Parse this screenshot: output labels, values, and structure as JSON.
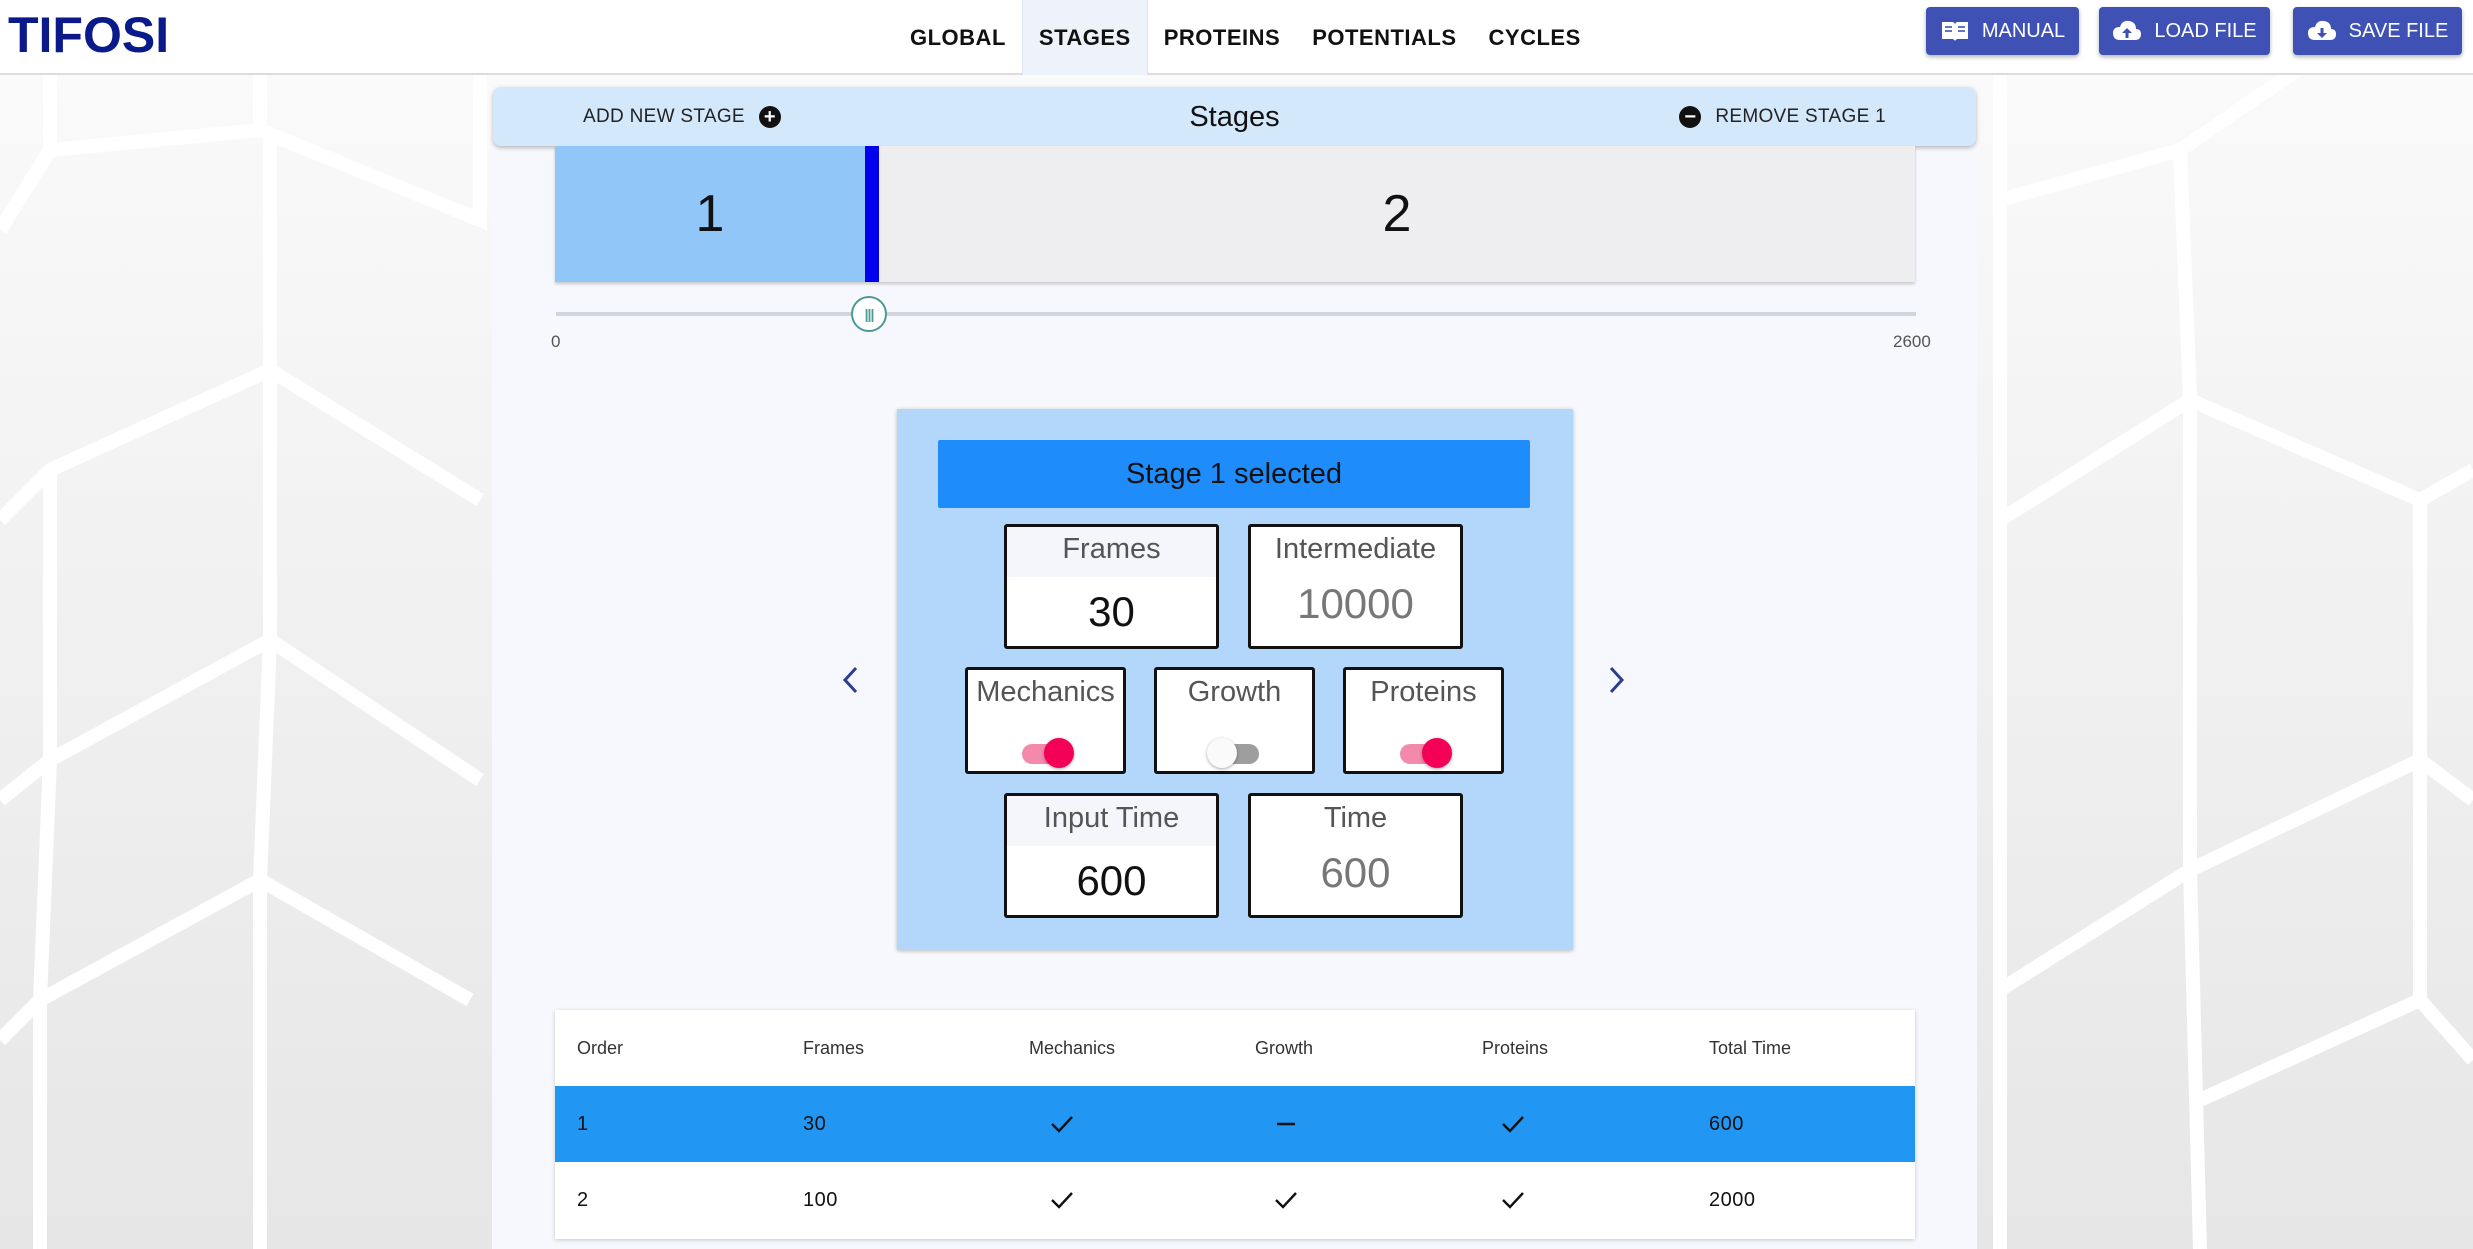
{
  "app": {
    "logo": "TIFOSI"
  },
  "nav": {
    "tabs": [
      {
        "label": "GLOBAL",
        "active": false
      },
      {
        "label": "STAGES",
        "active": true
      },
      {
        "label": "PROTEINS",
        "active": false
      },
      {
        "label": "POTENTIALS",
        "active": false
      },
      {
        "label": "CYCLES",
        "active": false
      }
    ],
    "buttons": [
      {
        "label": "MANUAL",
        "icon": "book-icon"
      },
      {
        "label": "LOAD FILE",
        "icon": "cloud-upload-icon"
      },
      {
        "label": "SAVE FILE",
        "icon": "cloud-download-icon"
      }
    ]
  },
  "stages_bar": {
    "add_label": "ADD NEW STAGE",
    "title": "Stages",
    "remove_label": "REMOVE STAGE 1"
  },
  "timeline": {
    "blocks": [
      "1",
      "2"
    ],
    "slider_min": "0",
    "slider_max": "2600",
    "slider_value": 600,
    "selected_block_color": "#90c6f8",
    "divider_color": "#0000ee"
  },
  "stage_card": {
    "header": "Stage 1 selected",
    "frames": {
      "label": "Frames",
      "value": "30"
    },
    "intermediate": {
      "label": "Intermediate",
      "value": "10000"
    },
    "toggles": [
      {
        "label": "Mechanics",
        "on": true
      },
      {
        "label": "Growth",
        "on": false
      },
      {
        "label": "Proteins",
        "on": true
      }
    ],
    "input_time": {
      "label": "Input Time",
      "value": "600"
    },
    "time": {
      "label": "Time",
      "value": "600"
    }
  },
  "table": {
    "headers": [
      "Order",
      "Frames",
      "Mechanics",
      "Growth",
      "Proteins",
      "Total Time"
    ],
    "rows": [
      {
        "order": "1",
        "frames": "30",
        "mechanics": "check",
        "growth": "dash",
        "proteins": "check",
        "total_time": "600",
        "selected": true
      },
      {
        "order": "2",
        "frames": "100",
        "mechanics": "check",
        "growth": "check",
        "proteins": "check",
        "total_time": "2000",
        "selected": false
      }
    ]
  },
  "colors": {
    "primary": "#3f51b5",
    "selected_row": "#2196f3",
    "card_bg": "#b3d7fb",
    "card_header": "#1e8cfa",
    "toggle_on": "#f50057"
  }
}
